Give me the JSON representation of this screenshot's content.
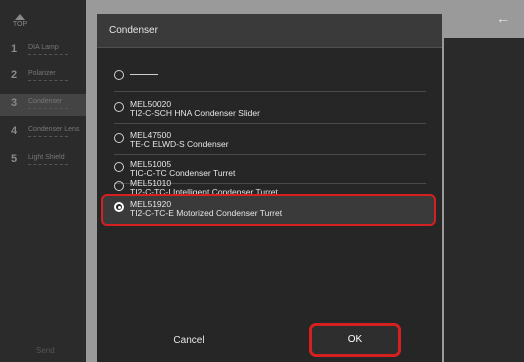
{
  "sidebar": {
    "top_label": "TOP",
    "steps": [
      {
        "num": "1",
        "label": "DIA Lamp"
      },
      {
        "num": "2",
        "label": "Polarizer"
      },
      {
        "num": "3",
        "label": "Condenser"
      },
      {
        "num": "4",
        "label": "Condenser Lens"
      },
      {
        "num": "5",
        "label": "Light Shield"
      }
    ],
    "send_label": "Send"
  },
  "header": {
    "back_icon": "←"
  },
  "modal": {
    "title": "Condenser",
    "options": [
      {
        "code": "",
        "desc": "—",
        "selected": false
      },
      {
        "code": "MEL50020",
        "desc": "TI2-C-SCH HNA Condenser Slider",
        "selected": false
      },
      {
        "code": "MEL47500",
        "desc": "TE-C ELWD-S Condenser",
        "selected": false
      },
      {
        "code": "MEL51005",
        "desc": "TIC-C-TC Condenser Turret",
        "selected": false
      },
      {
        "code": "MEL51010",
        "desc": "TI2-C-TC-I Intelligent Condenser Turret",
        "selected": false
      },
      {
        "code": "MEL51920",
        "desc": "TI2-C-TC-E Motorized Condenser Turret",
        "selected": true
      }
    ],
    "cancel_label": "Cancel",
    "ok_label": "OK"
  },
  "colors": {
    "highlight": "#d42020",
    "modal_bg": "#262626"
  }
}
